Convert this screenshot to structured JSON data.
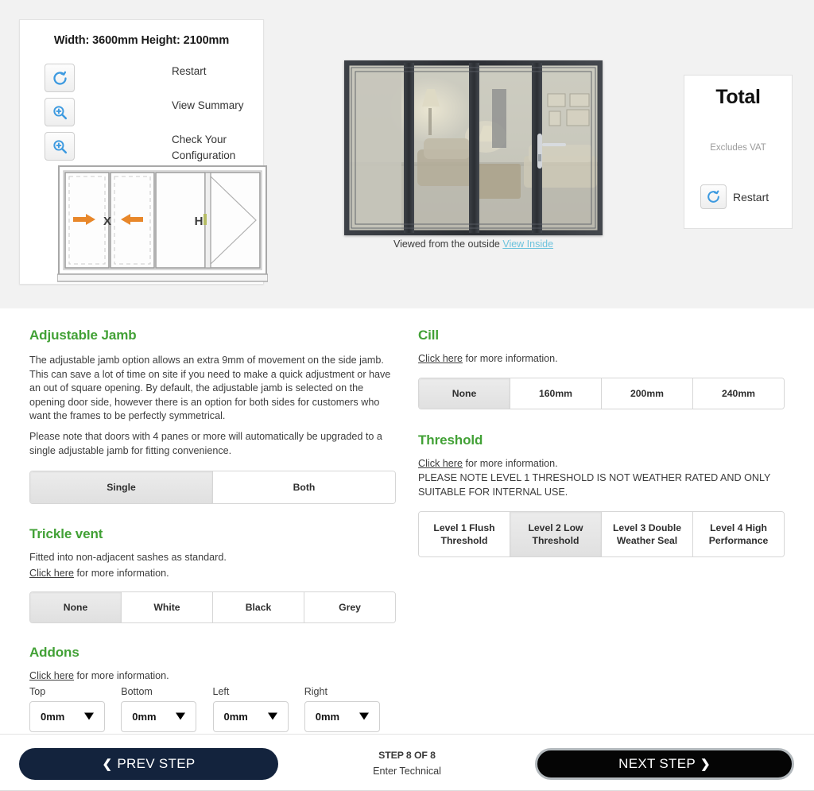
{
  "preview": {
    "dimensions_title": "Width: 3600mm Height: 2100mm",
    "actions": [
      {
        "icon": "restart-icon",
        "label": "Restart"
      },
      {
        "icon": "zoom-in-icon",
        "label": "View Summary"
      },
      {
        "icon": "zoom-in-icon",
        "label": "Check Your Configuration"
      }
    ],
    "schematic": {
      "marker_x": "X",
      "marker_h": "H",
      "panes": 4,
      "arrow_color": "#e8872a"
    },
    "photo_caption": "Viewed from the outside",
    "photo_caption_link": "View Inside",
    "total": {
      "title": "Total",
      "vat_note": "Excludes VAT",
      "restart_label": "Restart"
    }
  },
  "options": {
    "adjustable_jamb": {
      "title": "Adjustable Jamb",
      "body": "The adjustable jamb option allows an extra 9mm of movement on the side jamb. This can save a lot of time on site if you need to make a quick adjustment or have an out of square opening. By default, the adjustable jamb is selected on the opening door side, however there is an option for both sides for customers who want the frames to be perfectly symmetrical.",
      "body2": "Please note that doors with 4 panes or more will automatically be upgraded to a single adjustable jamb for fitting convenience.",
      "choices": [
        "Single",
        "Both"
      ],
      "selected": "Single"
    },
    "trickle_vent": {
      "title": "Trickle vent",
      "body": "Fitted into non-adjacent sashes as standard.",
      "link_text": "Click here",
      "link_suffix": " for more information.",
      "choices": [
        "None",
        "White",
        "Black",
        "Grey"
      ],
      "selected": "None"
    },
    "addons": {
      "title": "Addons",
      "link_text": "Click here",
      "link_suffix": " for more information.",
      "fields": [
        {
          "label": "Top",
          "value": "0mm"
        },
        {
          "label": "Bottom",
          "value": "0mm"
        },
        {
          "label": "Left",
          "value": "0mm"
        },
        {
          "label": "Right",
          "value": "0mm"
        }
      ]
    },
    "cill": {
      "title": "Cill",
      "link_text": "Click here",
      "link_suffix": " for more information.",
      "choices": [
        "None",
        "160mm",
        "200mm",
        "240mm"
      ],
      "selected": "None"
    },
    "threshold": {
      "title": "Threshold",
      "link_text": "Click here",
      "link_suffix": " for more information.",
      "note": "PLEASE NOTE LEVEL 1 THRESHOLD IS NOT WEATHER RATED AND ONLY SUITABLE FOR INTERNAL USE.",
      "choices": [
        "Level 1 Flush Threshold",
        "Level 2 Low Threshold",
        "Level 3 Double Weather Seal",
        "Level 4 High Performance"
      ],
      "selected": "Level 2 Low Threshold"
    }
  },
  "footer": {
    "prev_label": "PREV STEP",
    "next_label": "NEXT STEP",
    "prev_chevron": "❮",
    "next_chevron": "❯",
    "step_main": "STEP 8 OF 8",
    "step_sub": "Enter Technical"
  },
  "colors": {
    "accent_green": "#42a136",
    "navy": "#13233d",
    "link_blue": "#6ec3dd",
    "icon_blue": "#3d9ae0"
  }
}
